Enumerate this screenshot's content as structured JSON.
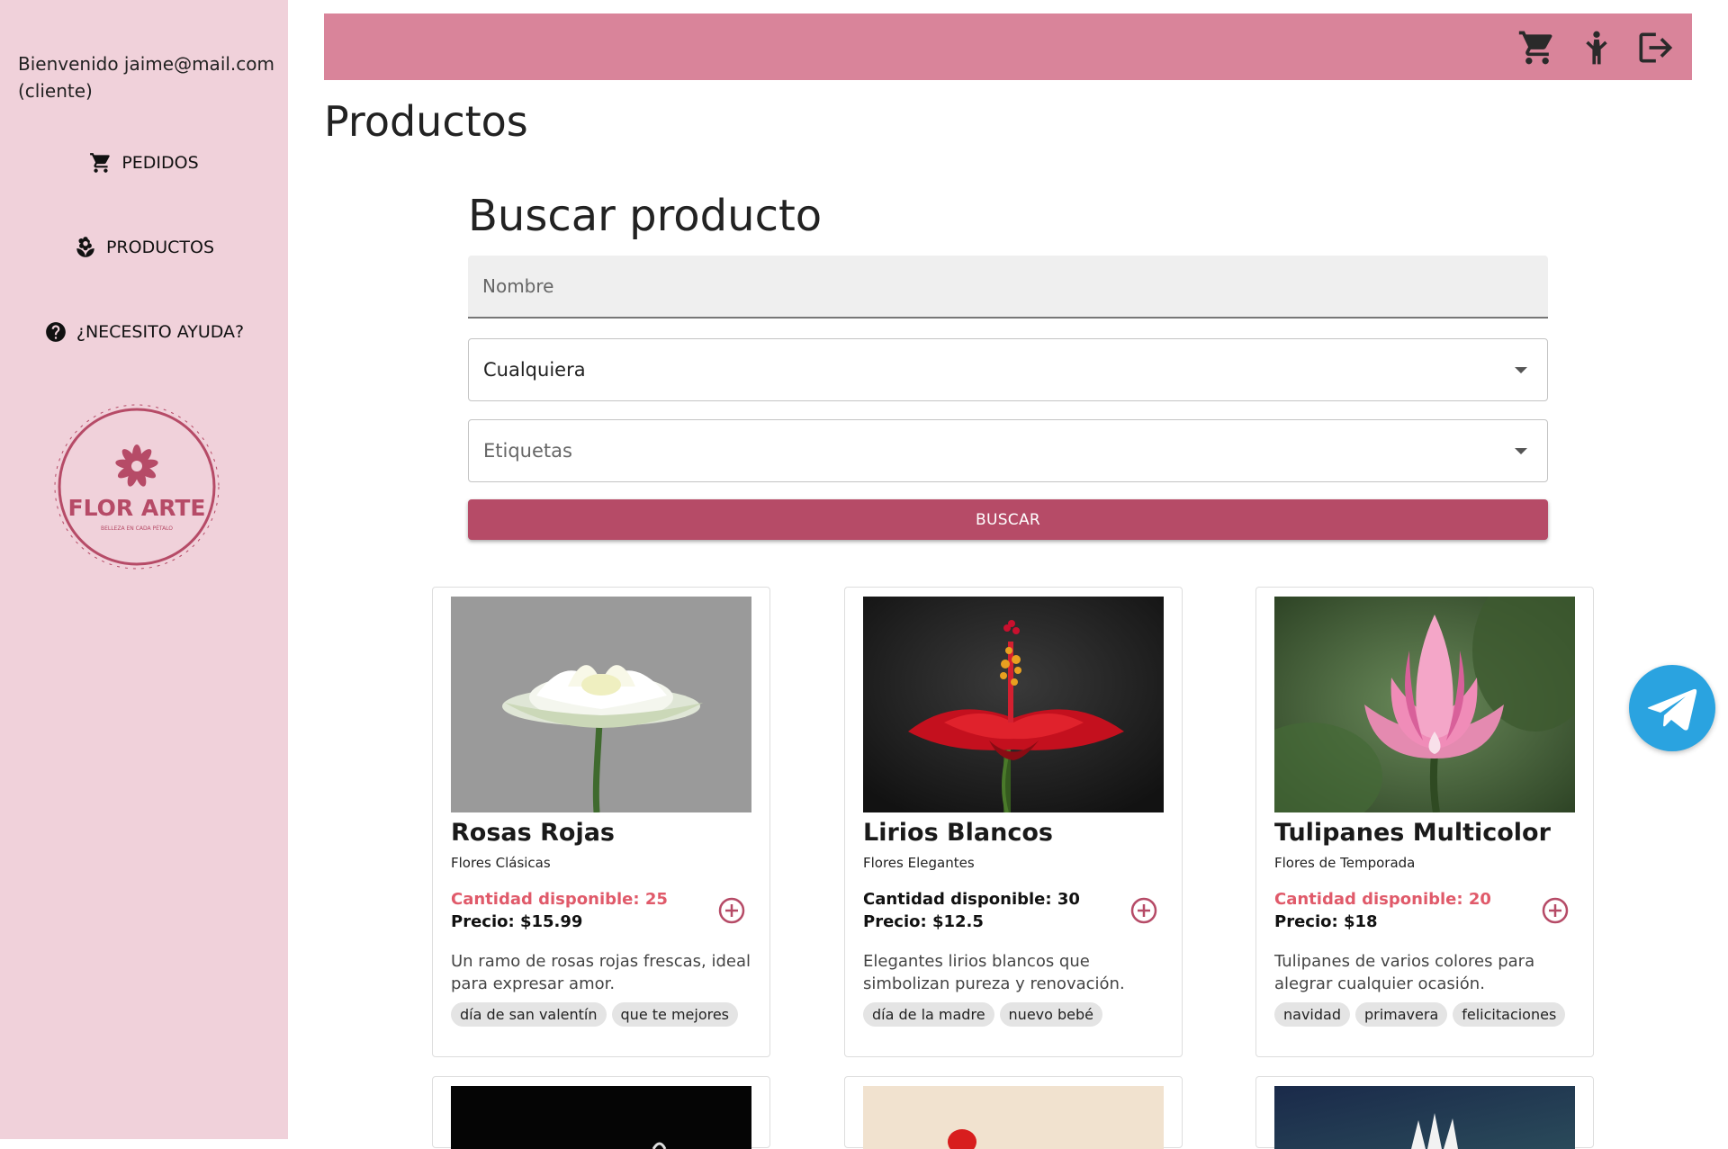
{
  "sidebar": {
    "welcome": "Bienvenido jaime@mail.com (cliente)",
    "items": [
      {
        "label": "PEDIDOS",
        "icon": "cart-icon"
      },
      {
        "label": "PRODUCTOS",
        "icon": "flower-icon"
      },
      {
        "label": "¿NECESITO AYUDA?",
        "icon": "help-icon"
      }
    ],
    "logo": {
      "title": "FLOR ARTE",
      "tagline": "BELLEZA EN CADA PÉTALO"
    }
  },
  "topbar": {
    "icons": [
      "cart-icon",
      "accessibility-icon",
      "logout-icon"
    ],
    "color": "#d9849a"
  },
  "page": {
    "title": "Productos"
  },
  "search": {
    "title": "Buscar producto",
    "name_placeholder": "Nombre",
    "category_value": "Cualquiera",
    "tags_placeholder": "Etiquetas",
    "button_label": "BUSCAR"
  },
  "products": [
    {
      "name": "Rosas Rojas",
      "category": "Flores Clásicas",
      "qty_label": "Cantidad disponible: 25",
      "qty_low": true,
      "price_label": "Precio: $15.99",
      "description": "Un ramo de rosas rojas frescas, ideal para expresar amor.",
      "tags": [
        "día de san valentín",
        "que te mejores"
      ]
    },
    {
      "name": "Lirios Blancos",
      "category": "Flores Elegantes",
      "qty_label": "Cantidad disponible: 30",
      "qty_low": false,
      "price_label": "Precio: $12.5",
      "description": "Elegantes lirios blancos que simbolizan pureza y renovación.",
      "tags": [
        "día de la madre",
        "nuevo bebé"
      ]
    },
    {
      "name": "Tulipanes Multicolor",
      "category": "Flores de Temporada",
      "qty_label": "Cantidad disponible: 20",
      "qty_low": true,
      "price_label": "Precio: $18",
      "description": "Tulipanes de varios colores para alegrar cualquier ocasión.",
      "tags": [
        "navidad",
        "primavera",
        "felicitaciones"
      ]
    }
  ],
  "colors": {
    "sidebar": "#f0d1da",
    "accent": "#b64b67",
    "low_stock": "#e05a6a"
  }
}
